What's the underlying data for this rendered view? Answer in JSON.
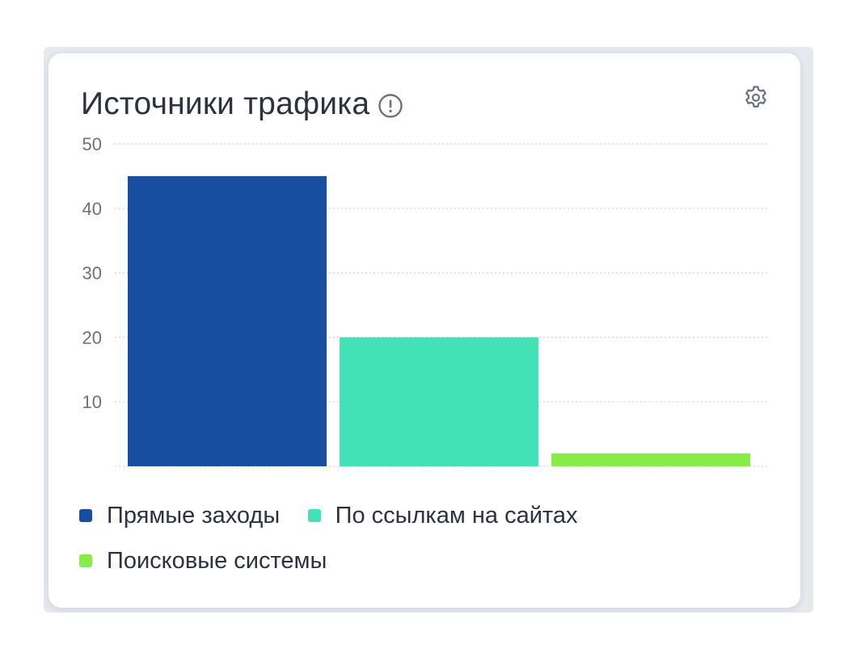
{
  "widget": {
    "title": "Источники трафика",
    "info_icon": "alert-circle-icon",
    "settings_icon": "gear-icon"
  },
  "colors": {
    "direct": "#184e9f",
    "referral": "#43e2b6",
    "search": "#87eb48",
    "grid": "#d3d6dd"
  },
  "chart_data": {
    "type": "bar",
    "title": "Источники трафика",
    "categories": [
      "Прямые заходы",
      "По ссылкам на сайтах",
      "Поисковые системы"
    ],
    "values": [
      45,
      20,
      2
    ],
    "colors": [
      "#184e9f",
      "#43e2b6",
      "#87eb48"
    ],
    "ylim": [
      0,
      50
    ],
    "yticks": [
      10,
      20,
      30,
      40,
      50
    ],
    "grid": true,
    "legend": "bottom",
    "xlabel": "",
    "ylabel": ""
  },
  "legend": [
    {
      "label": "Прямые заходы",
      "color": "#184e9f"
    },
    {
      "label": "По ссылкам на сайтах",
      "color": "#43e2b6"
    },
    {
      "label": "Поисковые системы",
      "color": "#87eb48"
    }
  ]
}
